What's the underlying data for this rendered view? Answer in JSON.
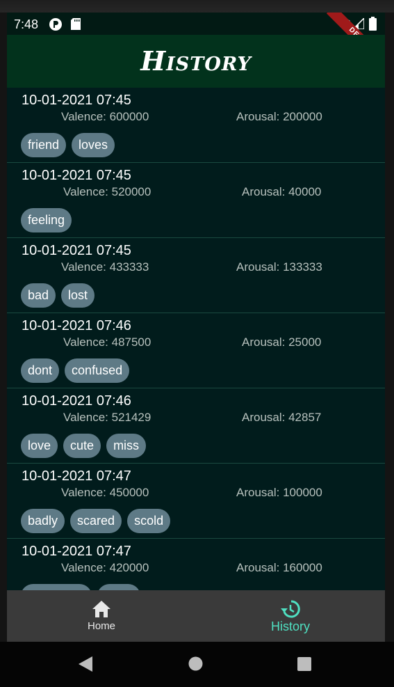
{
  "status_bar": {
    "time": "7:48",
    "debug_label": "DEBUG"
  },
  "app_bar": {
    "title": "History"
  },
  "entries": [
    {
      "date": "10-01-2021 07:45",
      "valence": "Valence: 600000",
      "arousal": "Arousal: 200000",
      "tags": [
        "friend",
        "loves"
      ]
    },
    {
      "date": "10-01-2021 07:45",
      "valence": "Valence: 520000",
      "arousal": "Arousal: 40000",
      "tags": [
        "feeling"
      ]
    },
    {
      "date": "10-01-2021 07:45",
      "valence": "Valence: 433333",
      "arousal": "Arousal: 133333",
      "tags": [
        "bad",
        "lost"
      ]
    },
    {
      "date": "10-01-2021 07:46",
      "valence": "Valence: 487500",
      "arousal": "Arousal: 25000",
      "tags": [
        "dont",
        "confused"
      ]
    },
    {
      "date": "10-01-2021 07:46",
      "valence": "Valence: 521429",
      "arousal": "Arousal: 42857",
      "tags": [
        "love",
        "cute",
        "miss"
      ]
    },
    {
      "date": "10-01-2021 07:47",
      "valence": "Valence: 450000",
      "arousal": "Arousal: 100000",
      "tags": [
        "badly",
        "scared",
        "scold"
      ]
    },
    {
      "date": "10-01-2021 07:47",
      "valence": "Valence: 420000",
      "arousal": "Arousal: 160000",
      "tags": []
    }
  ],
  "bottom_nav": {
    "items": [
      {
        "label": "Home",
        "icon": "home-icon",
        "active": false
      },
      {
        "label": "History",
        "icon": "history-icon",
        "active": true
      }
    ],
    "active_color": "#4fe0c1"
  },
  "colors": {
    "app_bar": "#02321c",
    "background": "#011c1c",
    "chip": "#5e7a86"
  }
}
